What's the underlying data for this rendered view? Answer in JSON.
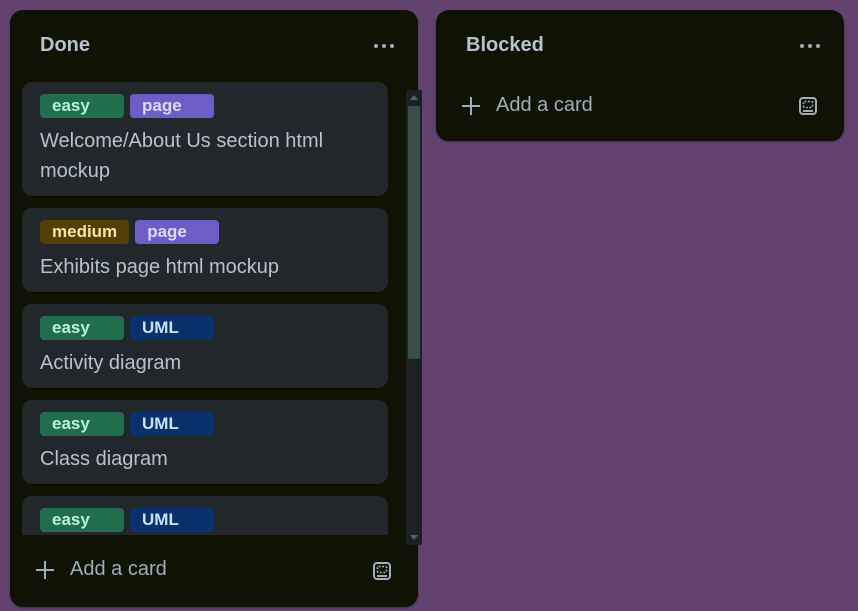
{
  "lists": [
    {
      "title": "Done",
      "cards": [
        {
          "labels": [
            {
              "text": "easy",
              "color": "#216e4e"
            },
            {
              "text": "page",
              "color": "#6e5dc6"
            }
          ],
          "title": "Welcome/About Us section html mockup"
        },
        {
          "labels": [
            {
              "text": "medium",
              "color": "#533f04"
            },
            {
              "text": "page",
              "color": "#6e5dc6"
            }
          ],
          "title": "Exhibits page html mockup"
        },
        {
          "labels": [
            {
              "text": "easy",
              "color": "#216e4e"
            },
            {
              "text": "UML",
              "color": "#09326c"
            }
          ],
          "title": "Activity diagram"
        },
        {
          "labels": [
            {
              "text": "easy",
              "color": "#216e4e"
            },
            {
              "text": "UML",
              "color": "#09326c"
            }
          ],
          "title": "Class diagram"
        },
        {
          "labels": [
            {
              "text": "easy",
              "color": "#216e4e"
            },
            {
              "text": "UML",
              "color": "#09326c"
            }
          ],
          "title": ""
        }
      ],
      "add_card_label": "Add a card",
      "menu_icon": "ellipsis-icon",
      "template_icon": "card-template-icon"
    },
    {
      "title": "Blocked",
      "cards": [],
      "add_card_label": "Add a card",
      "menu_icon": "ellipsis-icon",
      "template_icon": "card-template-icon"
    }
  ],
  "colors": {
    "board_background": "#624370",
    "list_background": "#101204",
    "card_background": "#22272b",
    "text": "#b6c2cf"
  }
}
